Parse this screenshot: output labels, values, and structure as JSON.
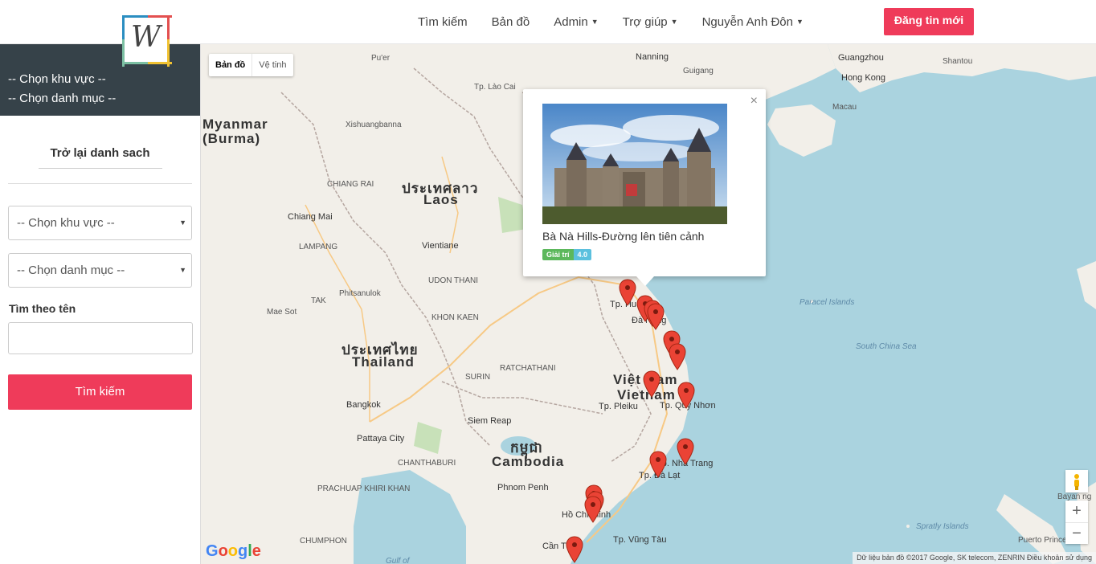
{
  "nav": {
    "logo_glyph": "W",
    "search": "Tìm kiếm",
    "map": "Bản đồ",
    "admin": "Admin",
    "help": "Trợ giúp",
    "user": "Nguyễn Anh Đôn",
    "post_button": "Đăng tin mới"
  },
  "sidebar": {
    "header_region": "-- Chọn khu vực --",
    "header_category": "-- Chọn danh mục --",
    "back_link": "Trở lại danh sach",
    "region_select": "-- Chọn khu vực --",
    "category_select": "-- Chọn danh mục --",
    "search_by_name_label": "Tìm theo tên",
    "name_input_value": "",
    "search_button": "Tìm kiếm"
  },
  "map": {
    "type_map": "Bản đồ",
    "type_satellite": "Vệ tinh",
    "labels": {
      "myanmar1": "Myanmar",
      "myanmar2": "(Burma)",
      "laos_th": "ประเทศลาว",
      "laos": "Laos",
      "thailand_th": "ประเทศไทย",
      "thailand": "Thailand",
      "cambodia_kh": "កម្ពុជា",
      "cambodia": "Cambodia",
      "vietnam1": "Việt Nam",
      "vietnam2": "Vietnam",
      "vientiane": "Vientiane",
      "bangkok": "Bangkok",
      "chiang_mai": "Chiang Mai",
      "phnom_penh": "Phnom Penh",
      "siem_reap": "Siem Reap",
      "pattaya": "Pattaya City",
      "hcm": "Hồ Chí Minh",
      "can_tho": "Cần Thơ",
      "vung_tau": "Tp. Vũng Tàu",
      "da_lat": "Tp. Đà Lạt",
      "nha_trang": "Tp. Nha Trang",
      "quy_nhon": "Tp. Quy Nhơn",
      "pleiku": "Tp. Pleiku",
      "hue": "Tp. Huế",
      "da_nang": "Đà Nẵng",
      "lao_cai": "Tp. Lào Cai",
      "nanning": "Nanning",
      "guangzhou": "Guangzhou",
      "hong_kong": "Hong Kong",
      "macau": "Macau",
      "shantou": "Shantou",
      "guigang": "Guigang",
      "xishuangbanna": "Xishuangbanna",
      "paracel": "Paracel Islands",
      "south_china_sea": "South China Sea",
      "spratly": "Spratly Islands",
      "gulf": "Gulf of",
      "puerto_princesa": "Puerto Princesa",
      "bayan": "Bayan ng",
      "udon_thani": "UDON THANI",
      "khon_kaen": "KHON KAEN",
      "ratchathani": "RATCHATHANI",
      "surin": "SURIN",
      "phitsanulok": "Phitsanulok",
      "lampang": "LAMPANG",
      "chiang_rai": "CHIANG RAI",
      "chanthaburi": "CHANTHABURI",
      "prachuap": "PRACHUAP KHIRI KHAN",
      "chumphon": "CHUMPHON",
      "tak": "TAK",
      "mae_sot": "Mae Sot",
      "puer": "Pu'er"
    },
    "popup": {
      "close": "×",
      "title": "Bà Nà Hills-Đường lên tiên cảnh",
      "category": "Giải trí",
      "rating": "4.0"
    },
    "zoom_in": "+",
    "zoom_out": "−",
    "google": "Google",
    "attribution": "Dữ liệu bản đồ ©2017 Google, SK telecom, ZENRIN   Điều khoản sử dụng"
  },
  "colors": {
    "accent": "#ef3b5a",
    "sidebar_header": "#364249",
    "water": "#aad3df",
    "land": "#f2efe9",
    "pin": "#ea4335"
  }
}
